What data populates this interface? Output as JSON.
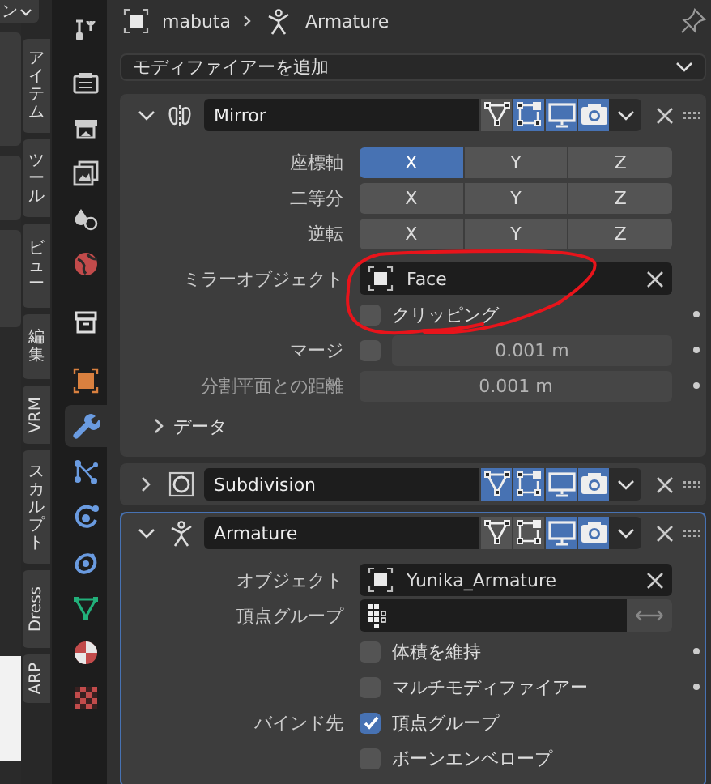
{
  "viewport": {
    "header_text": "ン"
  },
  "sidebar_tabs": [
    {
      "label": "アイテム",
      "kind": "stacked"
    },
    {
      "label": "ツール",
      "kind": "stacked"
    },
    {
      "label": "ビュー",
      "kind": "stacked"
    },
    {
      "label": "編集",
      "kind": "stacked"
    },
    {
      "label": "VRM",
      "kind": "rotated"
    },
    {
      "label": "スカルプト",
      "kind": "stacked"
    },
    {
      "label": "Dress",
      "kind": "rotated"
    },
    {
      "label": "ARP",
      "kind": "rotated"
    }
  ],
  "property_tabs": [
    {
      "kind": "tool",
      "selected": false
    },
    {
      "kind": "render",
      "selected": false
    },
    {
      "kind": "output",
      "selected": false
    },
    {
      "kind": "view_layer",
      "selected": false
    },
    {
      "kind": "scene",
      "selected": false
    },
    {
      "kind": "world",
      "selected": false
    },
    {
      "kind": "collection",
      "selected": false
    },
    {
      "kind": "object",
      "selected": false
    },
    {
      "kind": "modifier",
      "selected": true
    },
    {
      "kind": "particles",
      "selected": false
    },
    {
      "kind": "physics",
      "selected": false
    },
    {
      "kind": "constraint",
      "selected": false
    },
    {
      "kind": "data",
      "selected": false
    },
    {
      "kind": "material",
      "selected": false
    },
    {
      "kind": "texture",
      "selected": false
    }
  ],
  "header": {
    "object": "mabuta",
    "data": "Armature"
  },
  "add_modifier": "モディファイアーを追加",
  "modifiers": [
    {
      "kind": "mirror",
      "name": "Mirror",
      "expanded": true,
      "active": false,
      "edit_mode": false,
      "on_cage": true,
      "viewport": true,
      "render": true,
      "axis_rows": [
        {
          "label": "座標軸",
          "axes": [
            {
              "label": "X",
              "on": true
            },
            {
              "label": "Y",
              "on": false
            },
            {
              "label": "Z",
              "on": false
            }
          ]
        },
        {
          "label": "二等分",
          "axes": [
            {
              "label": "X",
              "on": false
            },
            {
              "label": "Y",
              "on": false
            },
            {
              "label": "Z",
              "on": false
            }
          ]
        },
        {
          "label": "逆転",
          "axes": [
            {
              "label": "X",
              "on": false
            },
            {
              "label": "Y",
              "on": false
            },
            {
              "label": "Z",
              "on": false
            }
          ]
        }
      ],
      "mirror_object": {
        "label": "ミラーオブジェクト",
        "value": "Face"
      },
      "clipping": {
        "label": "クリッピング",
        "checked": false
      },
      "merge": {
        "label": "マージ",
        "checked": false,
        "value": "0.001 m",
        "disabled": true
      },
      "bisect_distance": {
        "label": "分割平面との距離",
        "value": "0.001 m",
        "disabled": true
      },
      "subpanel": {
        "label": "データ",
        "expanded": false
      }
    },
    {
      "kind": "subdivision",
      "name": "Subdivision",
      "expanded": false,
      "active": false,
      "edit_mode": true,
      "on_cage": true,
      "viewport": true,
      "render": true
    },
    {
      "kind": "armature",
      "name": "Armature",
      "expanded": true,
      "active": true,
      "edit_mode": false,
      "on_cage": false,
      "viewport": true,
      "render": true,
      "object": {
        "label": "オブジェクト",
        "value": "Yunika_Armature"
      },
      "vertex_group": {
        "label": "頂点グループ",
        "invert": false
      },
      "options": [
        {
          "label": "体積を維持",
          "checked": false
        },
        {
          "label": "マルチモディファイアー",
          "checked": false
        }
      ],
      "bind_to": {
        "label": "バインド先",
        "options": [
          {
            "label": "頂点グループ",
            "checked": true
          },
          {
            "label": "ボーンエンベロープ",
            "checked": false
          }
        ]
      }
    }
  ],
  "annotation": {
    "kind": "freehand_circle"
  }
}
